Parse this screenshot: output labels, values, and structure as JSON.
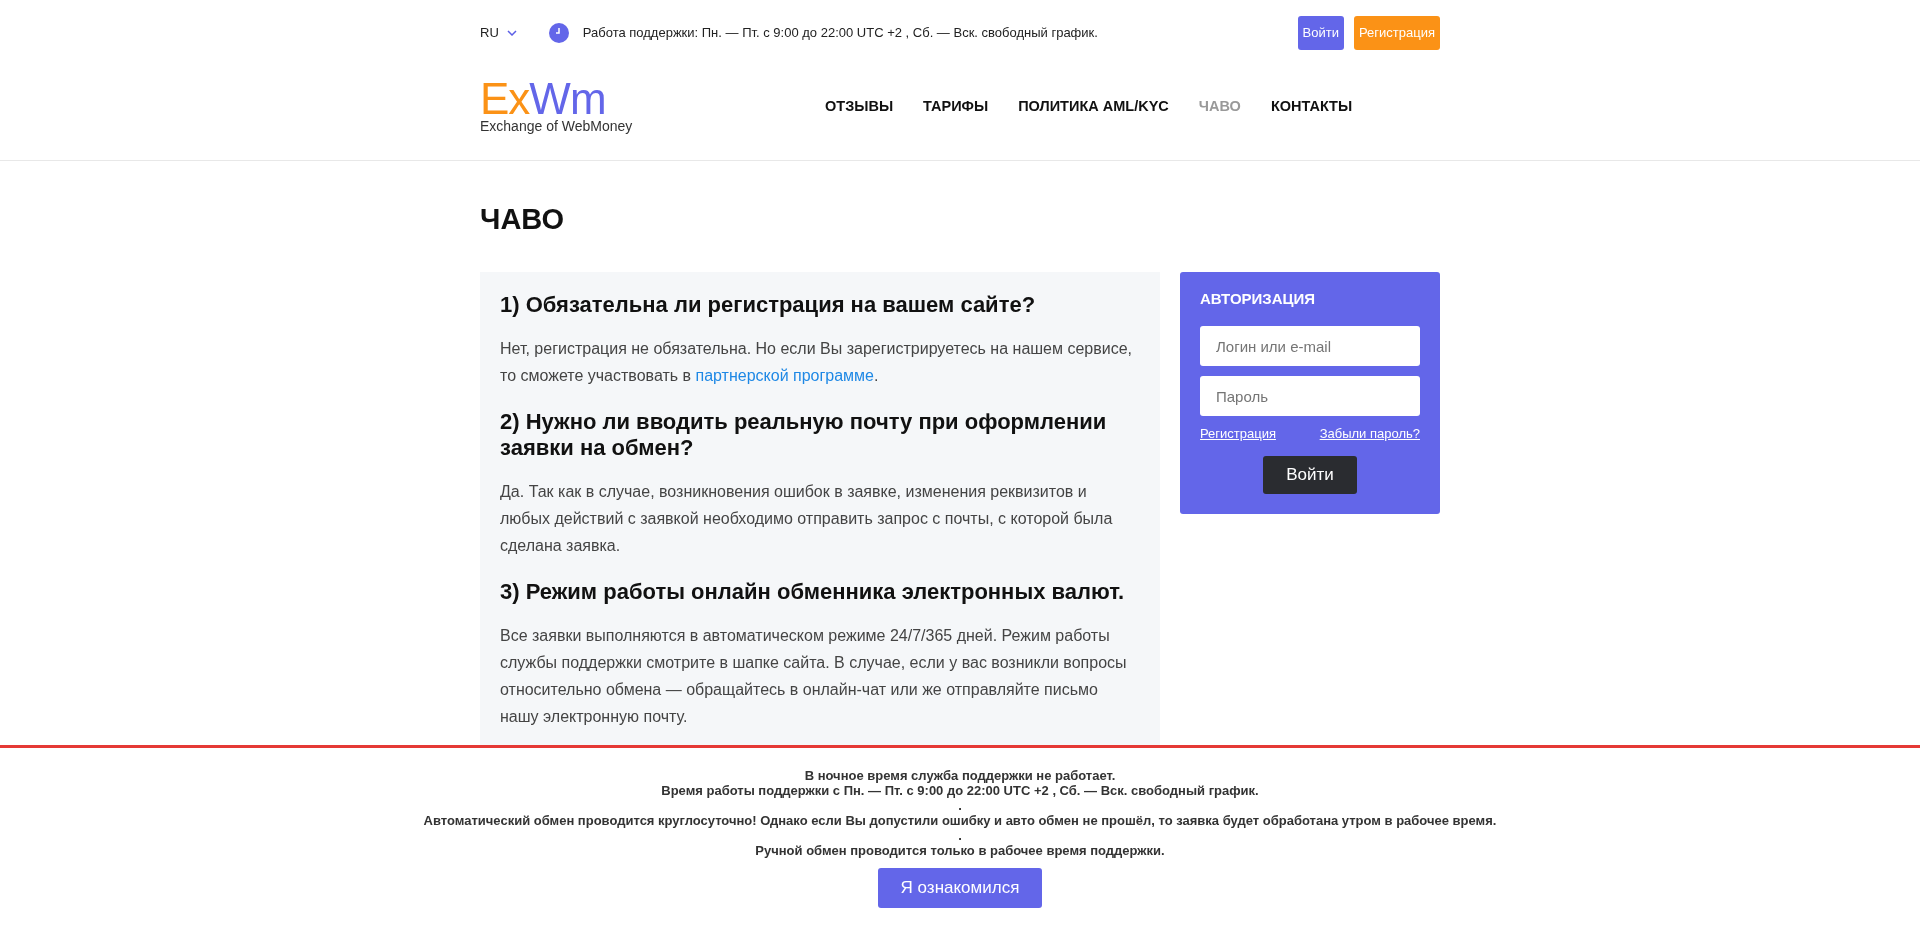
{
  "topbar": {
    "language": "RU",
    "support_hours": "Работа поддержки: Пн. — Пт. с 9:00 до 22:00 UTC +2 , Сб. — Вск. свободный график.",
    "buttons": [
      {
        "label": "Войти",
        "kind": "primary"
      },
      {
        "label": "Регистрация",
        "kind": "accent"
      }
    ]
  },
  "logo": {
    "part_1": "Ex",
    "part_2": "Wm",
    "tagline": "Exchange of WebMoney"
  },
  "nav": [
    {
      "label": "ОТЗЫВЫ",
      "selected": false
    },
    {
      "label": "ТАРИФЫ",
      "selected": false
    },
    {
      "label": "ПОЛИТИКА AML/KYC",
      "selected": false
    },
    {
      "label": "ЧАВО",
      "selected": true
    },
    {
      "label": "КОНТАКТЫ",
      "selected": false
    }
  ],
  "page_title": "ЧАВО",
  "faq": [
    {
      "question": "1) Обязательна ли регистрация на вашем сайте?",
      "answer": "Нет, регистрация не обязательна. Но если Вы зарегистрируетесь на нашем сервисе, то сможете участвовать в ",
      "link": "партнерской программе",
      "answer_end": "."
    },
    {
      "question": "2) Нужно ли вводить реальную почту при оформлении заявки на обмен?",
      "answer": "Да. Так как в случае, возникновения ошибок в заявке, изменения реквизитов и любых действий с заявкой необходимо отправить запрос с почты, с которой была сделана заявка."
    },
    {
      "question": "3) Режим работы онлайн обменника электронных валют.",
      "answer": "Все заявки выполняются в автоматическом режиме 24/7/365 дней. Режим работы службы поддержки смотрите в шапке сайта. В случае, если у вас возникли вопросы относительно обмена — обращайтесь в онлайн-чат или же отправляйте письмо нашу электронную почту."
    }
  ],
  "auth": {
    "title": "АВТОРИЗАЦИЯ",
    "login_placeholder": "Логин или e-mail",
    "password_placeholder": "Пароль",
    "register_link": "Регистрация",
    "forgot_link": "Забыли пароль?",
    "submit": "Войти"
  },
  "notice": {
    "lines": [
      "В ночное время служба поддержки не работает.",
      "Время работы поддержки с Пн. — Пт. с 9:00 до 22:00 UTC +2 , Сб. — Вск. свободный график.",
      ".",
      "Автоматический обмен проводится круглосуточно! Однако если Вы допустили ошибку и авто обмен не прошёл, то заявка будет обработана утром в рабочее время.",
      ".",
      "Ручной обмен проводится только в рабочее время поддержки."
    ],
    "button": "Я ознакомился"
  }
}
